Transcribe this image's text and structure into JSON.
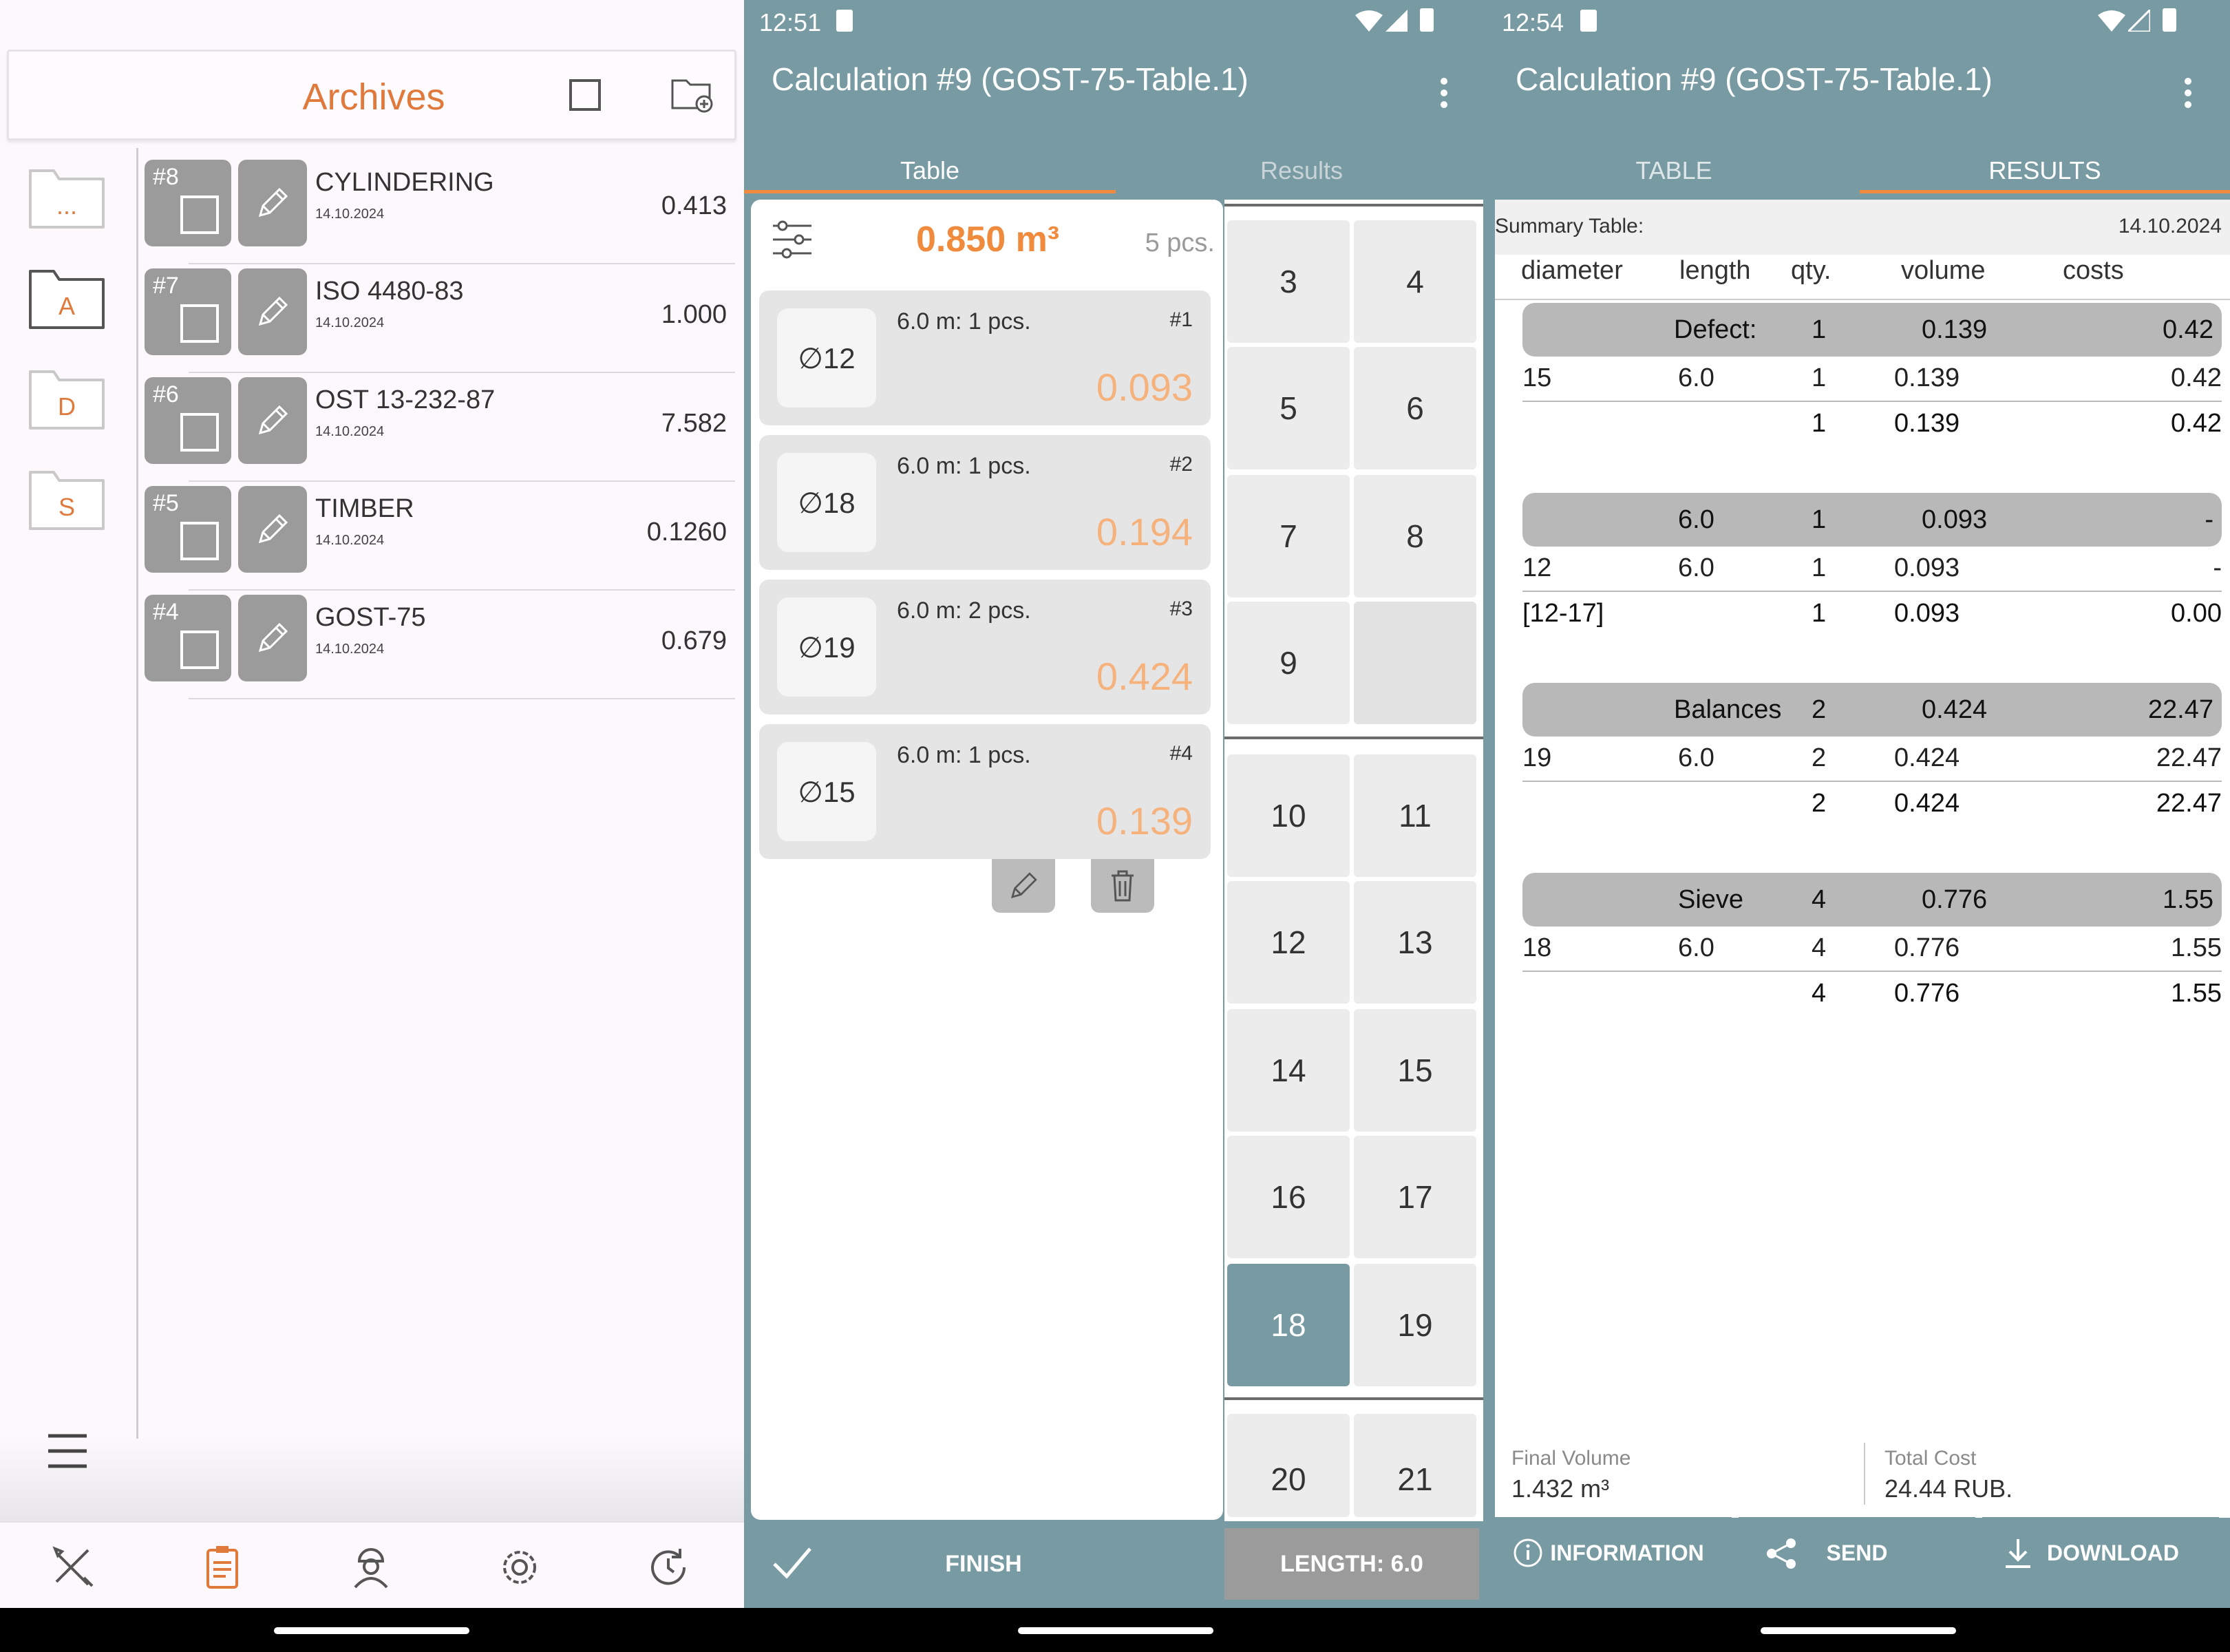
{
  "archives": {
    "title": "Archives",
    "folders": [
      "...",
      "A",
      "D",
      "S"
    ],
    "rows": [
      {
        "num": "#8",
        "name": "CYLINDERING",
        "date": "14.10.2024",
        "value": "0.413"
      },
      {
        "num": "#7",
        "name": "ISO 4480-83",
        "date": "14.10.2024",
        "value": "1.000"
      },
      {
        "num": "#6",
        "name": "OST 13-232-87",
        "date": "14.10.2024",
        "value": "7.582"
      },
      {
        "num": "#5",
        "name": "TIMBER",
        "date": "14.10.2024",
        "value": "0.1260"
      },
      {
        "num": "#4",
        "name": "GOST-75",
        "date": "14.10.2024",
        "value": "0.679"
      }
    ],
    "nav_icons": [
      "tools-icon",
      "clipboard-icon",
      "worker-icon",
      "settings-icon",
      "history-icon"
    ]
  },
  "table_screen": {
    "time": "12:51",
    "title": "Calculation #9 (GOST-75-Table.1)",
    "tabs": [
      "Table",
      "Results"
    ],
    "total_volume": "0.850 m³",
    "pcs": "5 pcs.",
    "entries": [
      {
        "diameter": "∅12",
        "length_qty": "6.0 m:  1 pcs.",
        "index": "#1",
        "volume": "0.093"
      },
      {
        "diameter": "∅18",
        "length_qty": "6.0 m:  1 pcs.",
        "index": "#2",
        "volume": "0.194"
      },
      {
        "diameter": "∅19",
        "length_qty": "6.0 m:  2 pcs.",
        "index": "#3",
        "volume": "0.424"
      },
      {
        "diameter": "∅15",
        "length_qty": "6.0 m:  1 pcs.",
        "index": "#4",
        "volume": "0.139"
      }
    ],
    "keys": [
      "3",
      "4",
      "5",
      "6",
      "7",
      "8",
      "9",
      "10",
      "11",
      "12",
      "13",
      "14",
      "15",
      "16",
      "17",
      "18",
      "19",
      "20",
      "21"
    ],
    "selected_key": "18",
    "finish_label": "FINISH",
    "length_label": "LENGTH: 6.0"
  },
  "results_screen": {
    "time": "12:54",
    "title": "Calculation #9 (GOST-75-Table.1)",
    "tabs": [
      "TABLE",
      "RESULTS"
    ],
    "summary_label": "Summary Table:",
    "date": "14.10.2024",
    "columns": [
      "diameter",
      "length",
      "qty.",
      "volume",
      "costs"
    ],
    "groups": [
      {
        "header": {
          "name": "Defect:",
          "qty": "1",
          "volume": "0.139",
          "cost": "0.42"
        },
        "row": {
          "d": "15",
          "len": "6.0",
          "qty": "1",
          "volume": "0.139",
          "cost": "0.42"
        },
        "total": {
          "d": "",
          "qty": "1",
          "volume": "0.139",
          "cost": "0.42"
        }
      },
      {
        "header": {
          "name": "6.0",
          "qty": "1",
          "volume": "0.093",
          "cost": "-"
        },
        "row": {
          "d": "12",
          "len": "6.0",
          "qty": "1",
          "volume": "0.093",
          "cost": "-"
        },
        "total": {
          "d": "[12-17]",
          "qty": "1",
          "volume": "0.093",
          "cost": "0.00"
        }
      },
      {
        "header": {
          "name": "Balances",
          "qty": "2",
          "volume": "0.424",
          "cost": "22.47"
        },
        "row": {
          "d": "19",
          "len": "6.0",
          "qty": "2",
          "volume": "0.424",
          "cost": "22.47"
        },
        "total": {
          "d": "",
          "qty": "2",
          "volume": "0.424",
          "cost": "22.47"
        }
      },
      {
        "header": {
          "name": "Sieve",
          "qty": "4",
          "volume": "0.776",
          "cost": "1.55"
        },
        "row": {
          "d": "18",
          "len": "6.0",
          "qty": "4",
          "volume": "0.776",
          "cost": "1.55"
        },
        "total": {
          "d": "",
          "qty": "4",
          "volume": "0.776",
          "cost": "1.55"
        }
      }
    ],
    "final_volume_label": "Final Volume",
    "final_volume": "1.432 m³",
    "total_cost_label": "Total Cost",
    "total_cost": "24.44 RUB.",
    "buttons": [
      "INFORMATION",
      "SEND",
      "DOWNLOAD"
    ]
  }
}
